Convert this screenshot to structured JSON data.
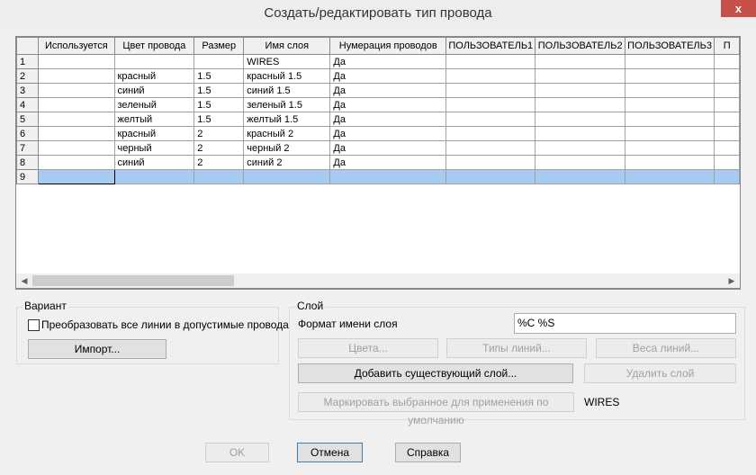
{
  "window": {
    "title": "Создать/редактировать тип провода",
    "close_glyph": "x"
  },
  "grid": {
    "columns": [
      "Используется",
      "Цвет провода",
      "Размер",
      "Имя слоя",
      "Нумерация проводов",
      "ПОЛЬЗОВАТЕЛЬ1",
      "ПОЛЬЗОВАТЕЛЬ2",
      "ПОЛЬЗОВАТЕЛЬ3",
      "П"
    ],
    "rows": [
      {
        "num": "1",
        "used": "",
        "color": "",
        "size": "",
        "layer": "WIRES",
        "numbering": "Да"
      },
      {
        "num": "2",
        "used": "",
        "color": "красный",
        "size": "1.5",
        "layer": "красный 1.5",
        "numbering": "Да"
      },
      {
        "num": "3",
        "used": "",
        "color": "синий",
        "size": "1.5",
        "layer": "синий 1.5",
        "numbering": "Да"
      },
      {
        "num": "4",
        "used": "",
        "color": "зеленый",
        "size": "1.5",
        "layer": "зеленый 1.5",
        "numbering": "Да"
      },
      {
        "num": "5",
        "used": "",
        "color": "желтый",
        "size": "1.5",
        "layer": "желтый 1.5",
        "numbering": "Да"
      },
      {
        "num": "6",
        "used": "",
        "color": "красный",
        "size": "2",
        "layer": "красный 2",
        "numbering": "Да"
      },
      {
        "num": "7",
        "used": "",
        "color": "черный",
        "size": "2",
        "layer": "черный 2",
        "numbering": "Да"
      },
      {
        "num": "8",
        "used": "",
        "color": "синий",
        "size": "2",
        "layer": "синий 2",
        "numbering": "Да"
      },
      {
        "num": "9",
        "used": "",
        "color": "",
        "size": "",
        "layer": "",
        "numbering": ""
      }
    ]
  },
  "variant": {
    "title": "Вариант",
    "convert_label": "Преобразовать все линии в допустимые провода",
    "import_label": "Импорт..."
  },
  "layer": {
    "title": "Слой",
    "format_label": "Формат имени слоя",
    "format_value": "%C %S",
    "colors_label": "Цвета...",
    "linetypes_label": "Типы линий...",
    "lineweights_label": "Веса линий...",
    "add_existing_label": "Добавить существующий слой...",
    "delete_label": "Удалить слой",
    "mark_default_label": "Маркировать выбранное для применения по умолчанию",
    "default_value": "WIRES"
  },
  "footer": {
    "ok_label": "OK",
    "cancel_label": "Отмена",
    "help_label": "Справка"
  }
}
